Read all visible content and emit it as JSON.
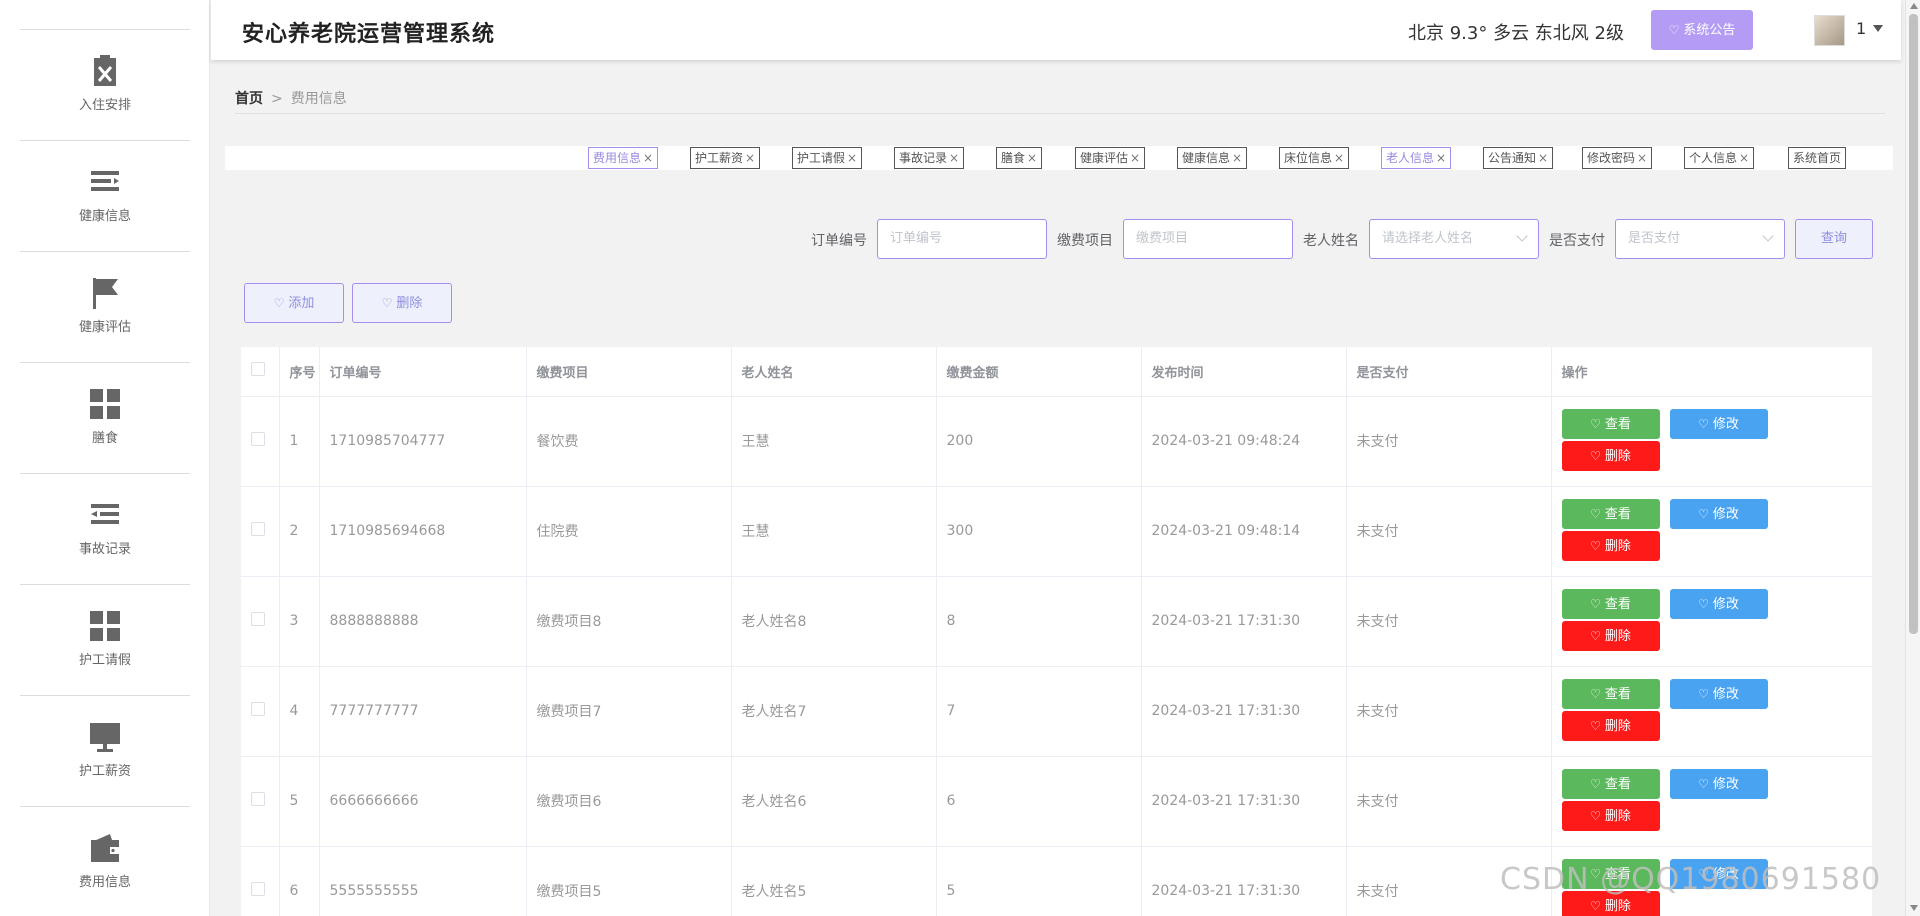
{
  "app": {
    "title": "安心养老院运营管理系统"
  },
  "header": {
    "weather": "北京  9.3°  多云  东北风  2级",
    "notice_label": "系统公告",
    "user": "1"
  },
  "sidebar": {
    "items": [
      {
        "label": "入住安排",
        "icon": "clipboard-x-icon"
      },
      {
        "label": "健康信息",
        "icon": "menu-list-icon"
      },
      {
        "label": "健康评估",
        "icon": "flag-icon"
      },
      {
        "label": "膳食",
        "icon": "grid-icon"
      },
      {
        "label": "事故记录",
        "icon": "outdent-icon"
      },
      {
        "label": "护工请假",
        "icon": "grid-icon"
      },
      {
        "label": "护工薪资",
        "icon": "monitor-icon"
      },
      {
        "label": "费用信息",
        "icon": "wallet-icon"
      }
    ]
  },
  "breadcrumb": {
    "home": "首页",
    "separator": ">",
    "current": "费用信息"
  },
  "tags": [
    {
      "label": "费用信息",
      "active": true
    },
    {
      "label": "护工薪资"
    },
    {
      "label": "护工请假"
    },
    {
      "label": "事故记录"
    },
    {
      "label": "膳食"
    },
    {
      "label": "健康评估"
    },
    {
      "label": "健康信息"
    },
    {
      "label": "床位信息"
    },
    {
      "label": "老人信息",
      "active": true
    },
    {
      "label": "公告通知"
    },
    {
      "label": "修改密码"
    },
    {
      "label": "个人信息"
    },
    {
      "label": "系统首页"
    }
  ],
  "search": {
    "order_label": "订单编号",
    "order_placeholder": "订单编号",
    "item_label": "缴费项目",
    "item_placeholder": "缴费项目",
    "elder_label": "老人姓名",
    "elder_placeholder": "请选择老人姓名",
    "paid_label": "是否支付",
    "paid_placeholder": "是否支付",
    "query_label": "查询"
  },
  "actions": {
    "add_label": "添加",
    "delete_label": "删除"
  },
  "table": {
    "columns": [
      "序号",
      "订单编号",
      "缴费项目",
      "老人姓名",
      "缴费金额",
      "发布时间",
      "是否支付",
      "操作"
    ],
    "view_label": "查看",
    "edit_label": "修改",
    "delete_label": "删除",
    "rows": [
      {
        "no": "1",
        "order": "1710985704777",
        "item": "餐饮费",
        "elder": "王慧",
        "amount": "200",
        "time": "2024-03-21 09:48:24",
        "paid": "未支付"
      },
      {
        "no": "2",
        "order": "1710985694668",
        "item": "住院费",
        "elder": "王慧",
        "amount": "300",
        "time": "2024-03-21 09:48:14",
        "paid": "未支付"
      },
      {
        "no": "3",
        "order": "8888888888",
        "item": "缴费项目8",
        "elder": "老人姓名8",
        "amount": "8",
        "time": "2024-03-21 17:31:30",
        "paid": "未支付"
      },
      {
        "no": "4",
        "order": "7777777777",
        "item": "缴费项目7",
        "elder": "老人姓名7",
        "amount": "7",
        "time": "2024-03-21 17:31:30",
        "paid": "未支付"
      },
      {
        "no": "5",
        "order": "6666666666",
        "item": "缴费项目6",
        "elder": "老人姓名6",
        "amount": "6",
        "time": "2024-03-21 17:31:30",
        "paid": "未支付"
      },
      {
        "no": "6",
        "order": "5555555555",
        "item": "缴费项目5",
        "elder": "老人姓名5",
        "amount": "5",
        "time": "2024-03-21 17:31:30",
        "paid": "未支付"
      }
    ]
  },
  "watermark": "CSDN @QQ1980691580",
  "colors": {
    "accent": "#a58ef0",
    "view": "#5cb85c",
    "edit": "#4aa3f0",
    "delete": "#ff1a1a"
  }
}
